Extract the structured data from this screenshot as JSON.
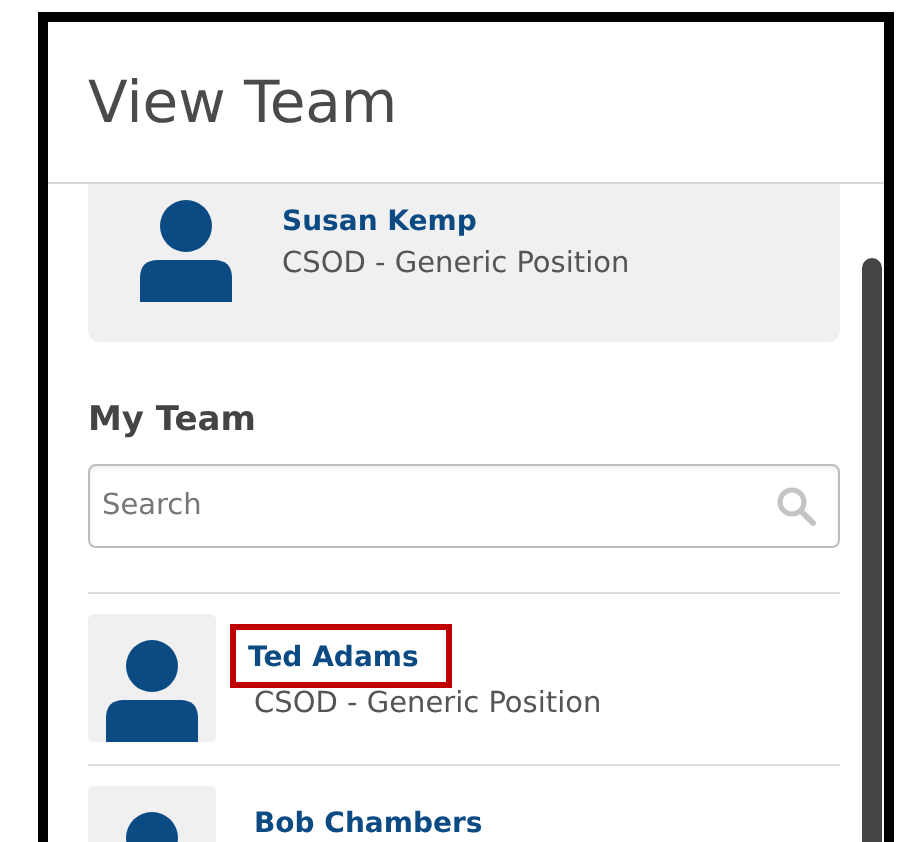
{
  "header": {
    "title": "View Team"
  },
  "manager": {
    "name": "Susan Kemp",
    "position": "CSOD - Generic Position"
  },
  "my_team": {
    "heading": "My Team",
    "search": {
      "placeholder": "Search"
    },
    "members": [
      {
        "name": "Ted Adams",
        "position": "CSOD - Generic Position",
        "highlighted": true
      },
      {
        "name": "Bob Chambers",
        "highlighted": false
      }
    ]
  }
}
